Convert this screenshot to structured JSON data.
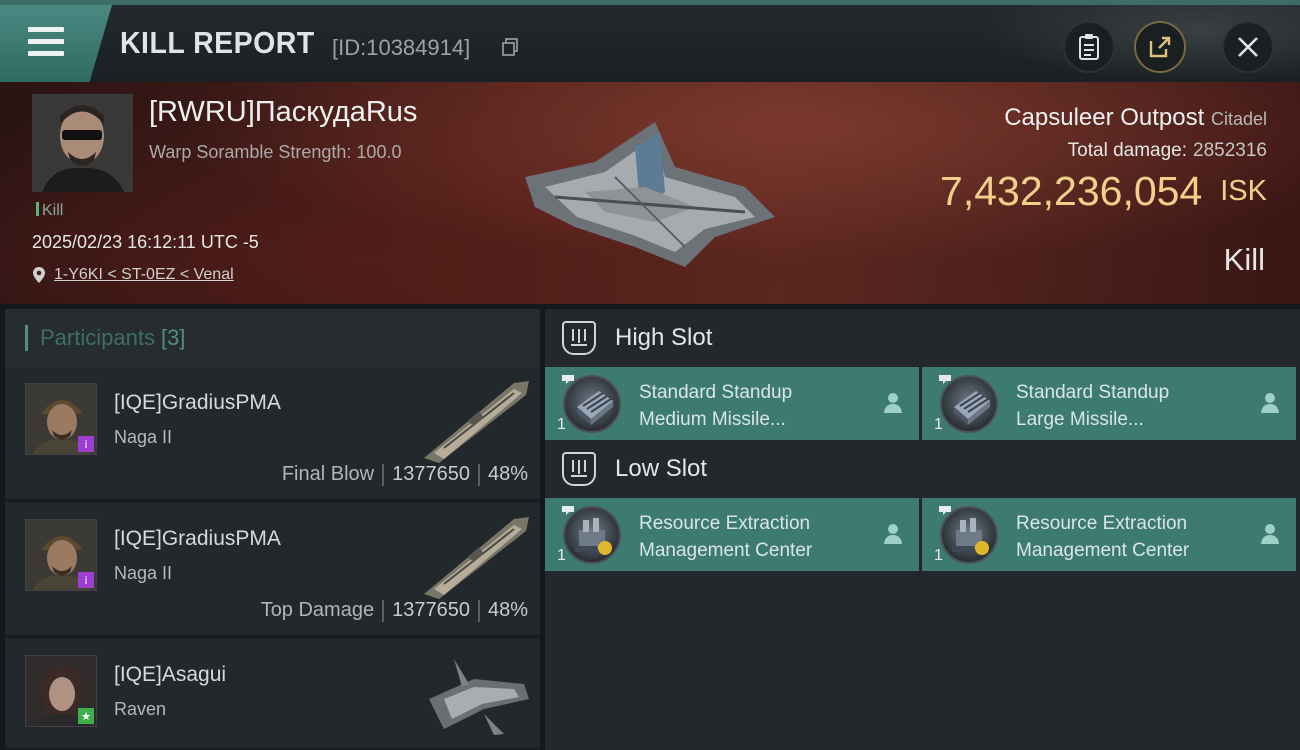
{
  "header": {
    "title": "KILL REPORT",
    "id": "[ID:10384914]"
  },
  "victim": {
    "name": "[RWRU]ПаскудаRus",
    "scramble": "Warp Soramble Strength: 100.0",
    "tag": "Kill",
    "datetime": "2025/02/23 16:12:11 UTC -5",
    "location": "1-Y6KI < ST-0EZ < Venal",
    "ship": "Capsuleer Outpost",
    "ship_class": "Citadel",
    "total_damage_label": "Total damage:",
    "total_damage": "2852316",
    "isk_value": "7,432,236,054",
    "isk_unit": "ISK",
    "result": "Kill"
  },
  "participants": {
    "label": "Participants",
    "count": "[3]",
    "items": [
      {
        "name": "[IQE]GradiusPMA",
        "ship": "Naga II",
        "stat_label": "Final Blow",
        "damage": "1377650",
        "percent": "48%",
        "badge": "i",
        "badge_color": "#9b3fd1"
      },
      {
        "name": "[IQE]GradiusPMA",
        "ship": "Naga II",
        "stat_label": "Top Damage",
        "damage": "1377650",
        "percent": "48%",
        "badge": "i",
        "badge_color": "#9b3fd1"
      },
      {
        "name": "[IQE]Asagui",
        "ship": "Raven",
        "stat_label": "",
        "damage": "",
        "percent": "",
        "badge": "★",
        "badge_color": "#3fae4f"
      }
    ]
  },
  "fittings": {
    "high_slot_label": "High Slot",
    "low_slot_label": "Low Slot",
    "high": [
      {
        "line1": "Standard Standup",
        "line2": "Medium Missile...",
        "qty": "1"
      },
      {
        "line1": "Standard Standup",
        "line2": "Large Missile...",
        "qty": "1"
      }
    ],
    "low": [
      {
        "line1": "Resource Extraction",
        "line2": "Management Center",
        "qty": "1"
      },
      {
        "line1": "Resource Extraction",
        "line2": "Management Center",
        "qty": "1"
      }
    ]
  },
  "colors": {
    "accent": "#3c7a72",
    "isk": "#f2cf8a"
  }
}
